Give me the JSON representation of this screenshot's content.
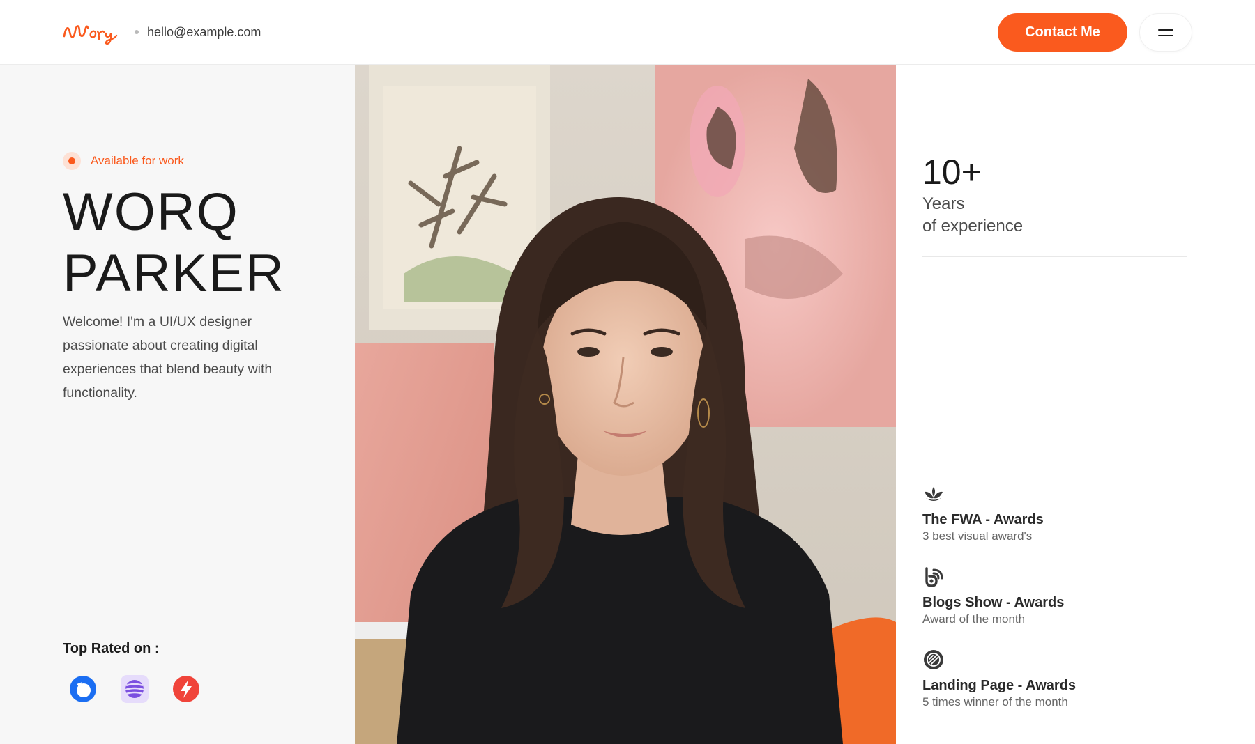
{
  "header": {
    "logo_text": "Worq",
    "email": "hello@example.com",
    "contact_label": "Contact Me",
    "menu_icon": "hamburger-icon"
  },
  "hero": {
    "availability": "Available for work",
    "name_line1": "WORQ",
    "name_line2": "PARKER",
    "intro": "Welcome! I'm a UI/UX designer passionate about creating digital experiences that blend beauty with functionality.",
    "top_rated_label": "Top Rated on :",
    "platforms": [
      {
        "icon": "blue-circle-platform-icon",
        "color": "#1b6ef2"
      },
      {
        "icon": "purple-stripes-platform-icon",
        "color": "#7b4fe0"
      },
      {
        "icon": "red-bolt-platform-icon",
        "color": "#f0443a"
      }
    ]
  },
  "experience": {
    "number": "10+",
    "label_line1": "Years",
    "label_line2": "of experience"
  },
  "awards": [
    {
      "icon": "lotus-icon",
      "title": "The FWA - Awards",
      "subtitle": "3 best visual award's"
    },
    {
      "icon": "blog-b-icon",
      "title": "Blogs Show - Awards",
      "subtitle": "Award of the month"
    },
    {
      "icon": "badge-circle-icon",
      "title": "Landing Page - Awards",
      "subtitle": "5 times winner of the month"
    }
  ],
  "colors": {
    "accent": "#fa5a1e",
    "left_bg": "#f7f7f7"
  }
}
